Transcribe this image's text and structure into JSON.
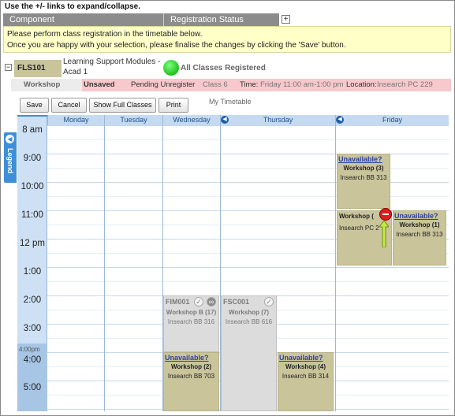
{
  "hint": "Use the +/- links to expand/collapse.",
  "header": {
    "component": "Component",
    "status": "Registration Status",
    "expand_symbol": "+"
  },
  "notice": {
    "line1": "Please perform class registration in the timetable below.",
    "line2": "Once you are happy with your selection, please finalise the changes by clicking the 'Save' button."
  },
  "course": {
    "collapse_symbol": "−",
    "code": "FLS101",
    "title_line1": "Learning Support Modules -",
    "title_line2": "Acad 1",
    "status": "All Classes Registered"
  },
  "status_bar": {
    "component": "Workshop",
    "state": "Unsaved",
    "action": "Pending Unregister",
    "class": "Class 6",
    "time_label": "Time:",
    "time": "Friday 11:00 am-1:00 pm",
    "location_label": "Location:",
    "location": "Insearch PC 229"
  },
  "toolbar": {
    "save": "Save",
    "cancel": "Cancel",
    "show_full": "Show Full Classes",
    "print": "Print",
    "my_timetable": "My Timetable"
  },
  "legend": {
    "label": "Legend"
  },
  "days": [
    "Monday",
    "Tuesday",
    "Wednesday",
    "Thursday",
    "Friday"
  ],
  "times": [
    "8 am",
    "9:00",
    "10:00",
    "11:00",
    "12 pm",
    "1:00",
    "2:00",
    "3:00",
    "4:00",
    "5:00"
  ],
  "pm_marker": "4:00pm",
  "blocks": {
    "fri_workshop3": {
      "unavailable": "Unavailable?",
      "name": "Workshop (3)",
      "location": "Insearch BB 313"
    },
    "fri_workshop_x": {
      "name": "Workshop (",
      "location": "Insearch PC 2"
    },
    "fri_workshop1": {
      "unavailable": "Unavailable?",
      "name": "Workshop (1)",
      "location": "Insearch BB 313"
    },
    "wed_fim": {
      "code": "FIM001",
      "name": "Workshop B (17)",
      "location": "Insearch BB 316"
    },
    "thu_fsc": {
      "code": "FSC001",
      "name": "Workshop (7)",
      "location": "Insearch BB 616"
    },
    "wed_workshop2": {
      "unavailable": "Unavailable?",
      "name": "Workshop (2)",
      "location": "Insearch BB 703"
    },
    "thu_workshop4": {
      "unavailable": "Unavailable?",
      "name": "Workshop (4)",
      "location": "Insearch BB 314"
    }
  },
  "colors": {
    "accent_blue": "#3f8fd8",
    "olive": "#c9c49a",
    "pending_pink": "#f7c8cc",
    "notice_yellow": "#ffffc8"
  }
}
